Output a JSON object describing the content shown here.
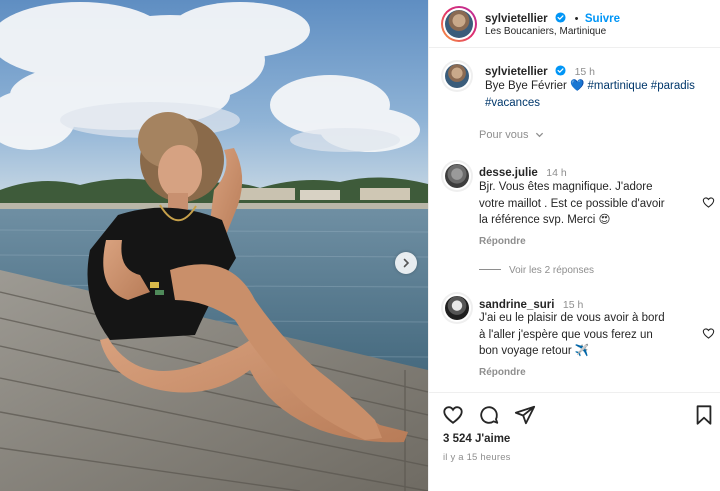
{
  "post": {
    "username": "sylvietellier",
    "follow_label": "Suivre",
    "separator": "•",
    "location": "Les Boucaniers, Martinique"
  },
  "caption": {
    "username": "sylvietellier",
    "time": "15 h",
    "text_before": "Bye Bye Février ",
    "emoji": "💙",
    "hashtags_line1": " #martinique #paradis",
    "hashtags_line2": "#vacances",
    "for_you": "Pour vous"
  },
  "comments": [
    {
      "username": "desse.julie",
      "time": "14 h",
      "lines": [
        "Bjr. Vous êtes magnifique. J'adore",
        "votre maillot . Est ce possible d'avoir",
        "la référence svp. Merci 😍"
      ],
      "reply_label": "Répondre",
      "view_replies": "Voir les 2 réponses"
    },
    {
      "username": "sandrine_suri",
      "time": "15 h",
      "lines": [
        "J'ai eu le plaisir de vous avoir à bord",
        "à l'aller j'espère que vous ferez un",
        "bon voyage retour ✈️"
      ],
      "reply_label": "Répondre"
    }
  ],
  "footer": {
    "likes": "3 524 J'aime",
    "ago": "il y a 15 heures"
  },
  "icons": {
    "heart": "heart-icon",
    "comment": "comment-icon",
    "share": "paper-plane-icon",
    "save": "bookmark-icon",
    "next": "chevron-right-icon",
    "verified": "verified-badge-icon"
  },
  "colors": {
    "link_blue": "#0095f6",
    "hashtag": "#00376b",
    "muted": "#8e8e8e",
    "verified": "#0095f6"
  }
}
